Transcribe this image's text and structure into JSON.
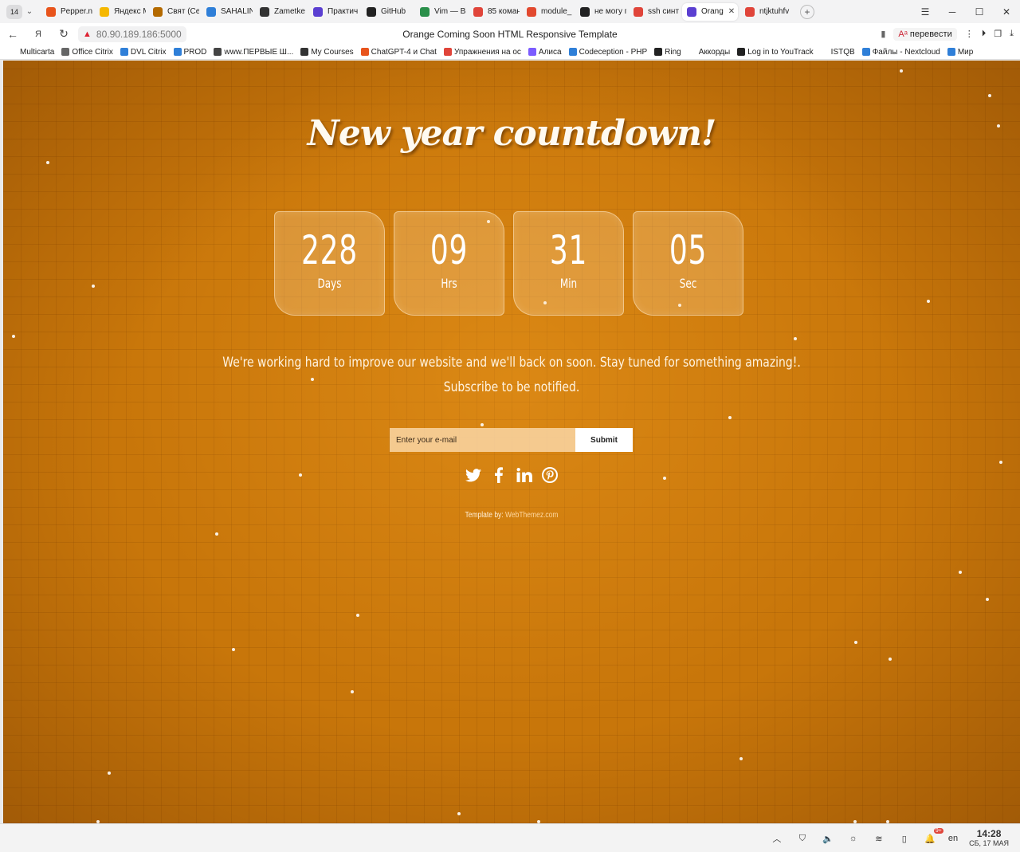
{
  "browser": {
    "tab_count": "14",
    "tabs": [
      {
        "label": "Pepper.n",
        "color": "#e8541c"
      },
      {
        "label": "Яндекс М",
        "color": "#f5b800"
      },
      {
        "label": "Свят (Се",
        "color": "#b46a00"
      },
      {
        "label": "SAHALIN",
        "color": "#2f7fd8"
      },
      {
        "label": "Zametke",
        "color": "#333333"
      },
      {
        "label": "Практич",
        "color": "#5b3fd1"
      },
      {
        "label": "GitHub",
        "color": "#222222"
      },
      {
        "label": "Vim — Bi",
        "color": "#2a8f4a"
      },
      {
        "label": "85 коман",
        "color": "#e0453a"
      },
      {
        "label": "module_",
        "color": "#e2492f"
      },
      {
        "label": "не могу г",
        "color": "#222222"
      },
      {
        "label": "ssh синт",
        "color": "#e0453a"
      },
      {
        "label": "Orang",
        "color": "#5b3fd1"
      },
      {
        "label": "ntjktuhfv",
        "color": "#e0453a"
      }
    ],
    "active_tab_index": 12,
    "url": "80.90.189.186:5000",
    "page_title": "Orange Coming Soon HTML Responsive Template",
    "translate_label": "перевести",
    "bookmarks": [
      {
        "label": "Multicarta",
        "color": "#ffffff"
      },
      {
        "label": "Office Citrix",
        "color": "#666666"
      },
      {
        "label": "DVL Citrix",
        "color": "#2f7fd8"
      },
      {
        "label": "PROD",
        "color": "#2f7fd8"
      },
      {
        "label": "www.ПЕРВЫЕ Ш...",
        "color": "#444444"
      },
      {
        "label": "My Courses",
        "color": "#333333"
      },
      {
        "label": "ChatGPT-4 и Chat",
        "color": "#e8541c"
      },
      {
        "label": "Упражнения на ос",
        "color": "#e0453a"
      },
      {
        "label": "Алиса",
        "color": "#7b5cff"
      },
      {
        "label": "Codeception - PHP",
        "color": "#2f7fd8"
      },
      {
        "label": "Ring",
        "color": "#222222"
      },
      {
        "label": "Аккорды",
        "color": "#ffffff"
      },
      {
        "label": "Log in to YouTrack",
        "color": "#222222"
      },
      {
        "label": "ISTQB",
        "color": "#ffffff"
      },
      {
        "label": "Файлы - Nextcloud",
        "color": "#2f7fd8"
      },
      {
        "label": "Мир",
        "color": "#2f7fd8"
      }
    ]
  },
  "page": {
    "headline": "New year countdown!",
    "countdown": [
      {
        "value": "228",
        "label": "Days"
      },
      {
        "value": "09",
        "label": "Hrs"
      },
      {
        "value": "31",
        "label": "Min"
      },
      {
        "value": "05",
        "label": "Sec"
      }
    ],
    "tagline_1": "We're working hard to improve our website and we'll back on soon. Stay tuned for something amazing!.",
    "tagline_2": "Subscribe to be notified.",
    "email_placeholder": "Enter your e-mail",
    "submit_label": "Submit",
    "social": [
      "twitter-icon",
      "facebook-icon",
      "linkedin-icon",
      "pinterest-icon"
    ],
    "credit_prefix": "Template by:",
    "credit_link": "WebThemez.com",
    "accent_bg": "#c8760a"
  },
  "taskbar": {
    "lang": "en",
    "notif_badge": "9+",
    "time": "14:28",
    "date": "СБ, 17 МАЯ"
  }
}
